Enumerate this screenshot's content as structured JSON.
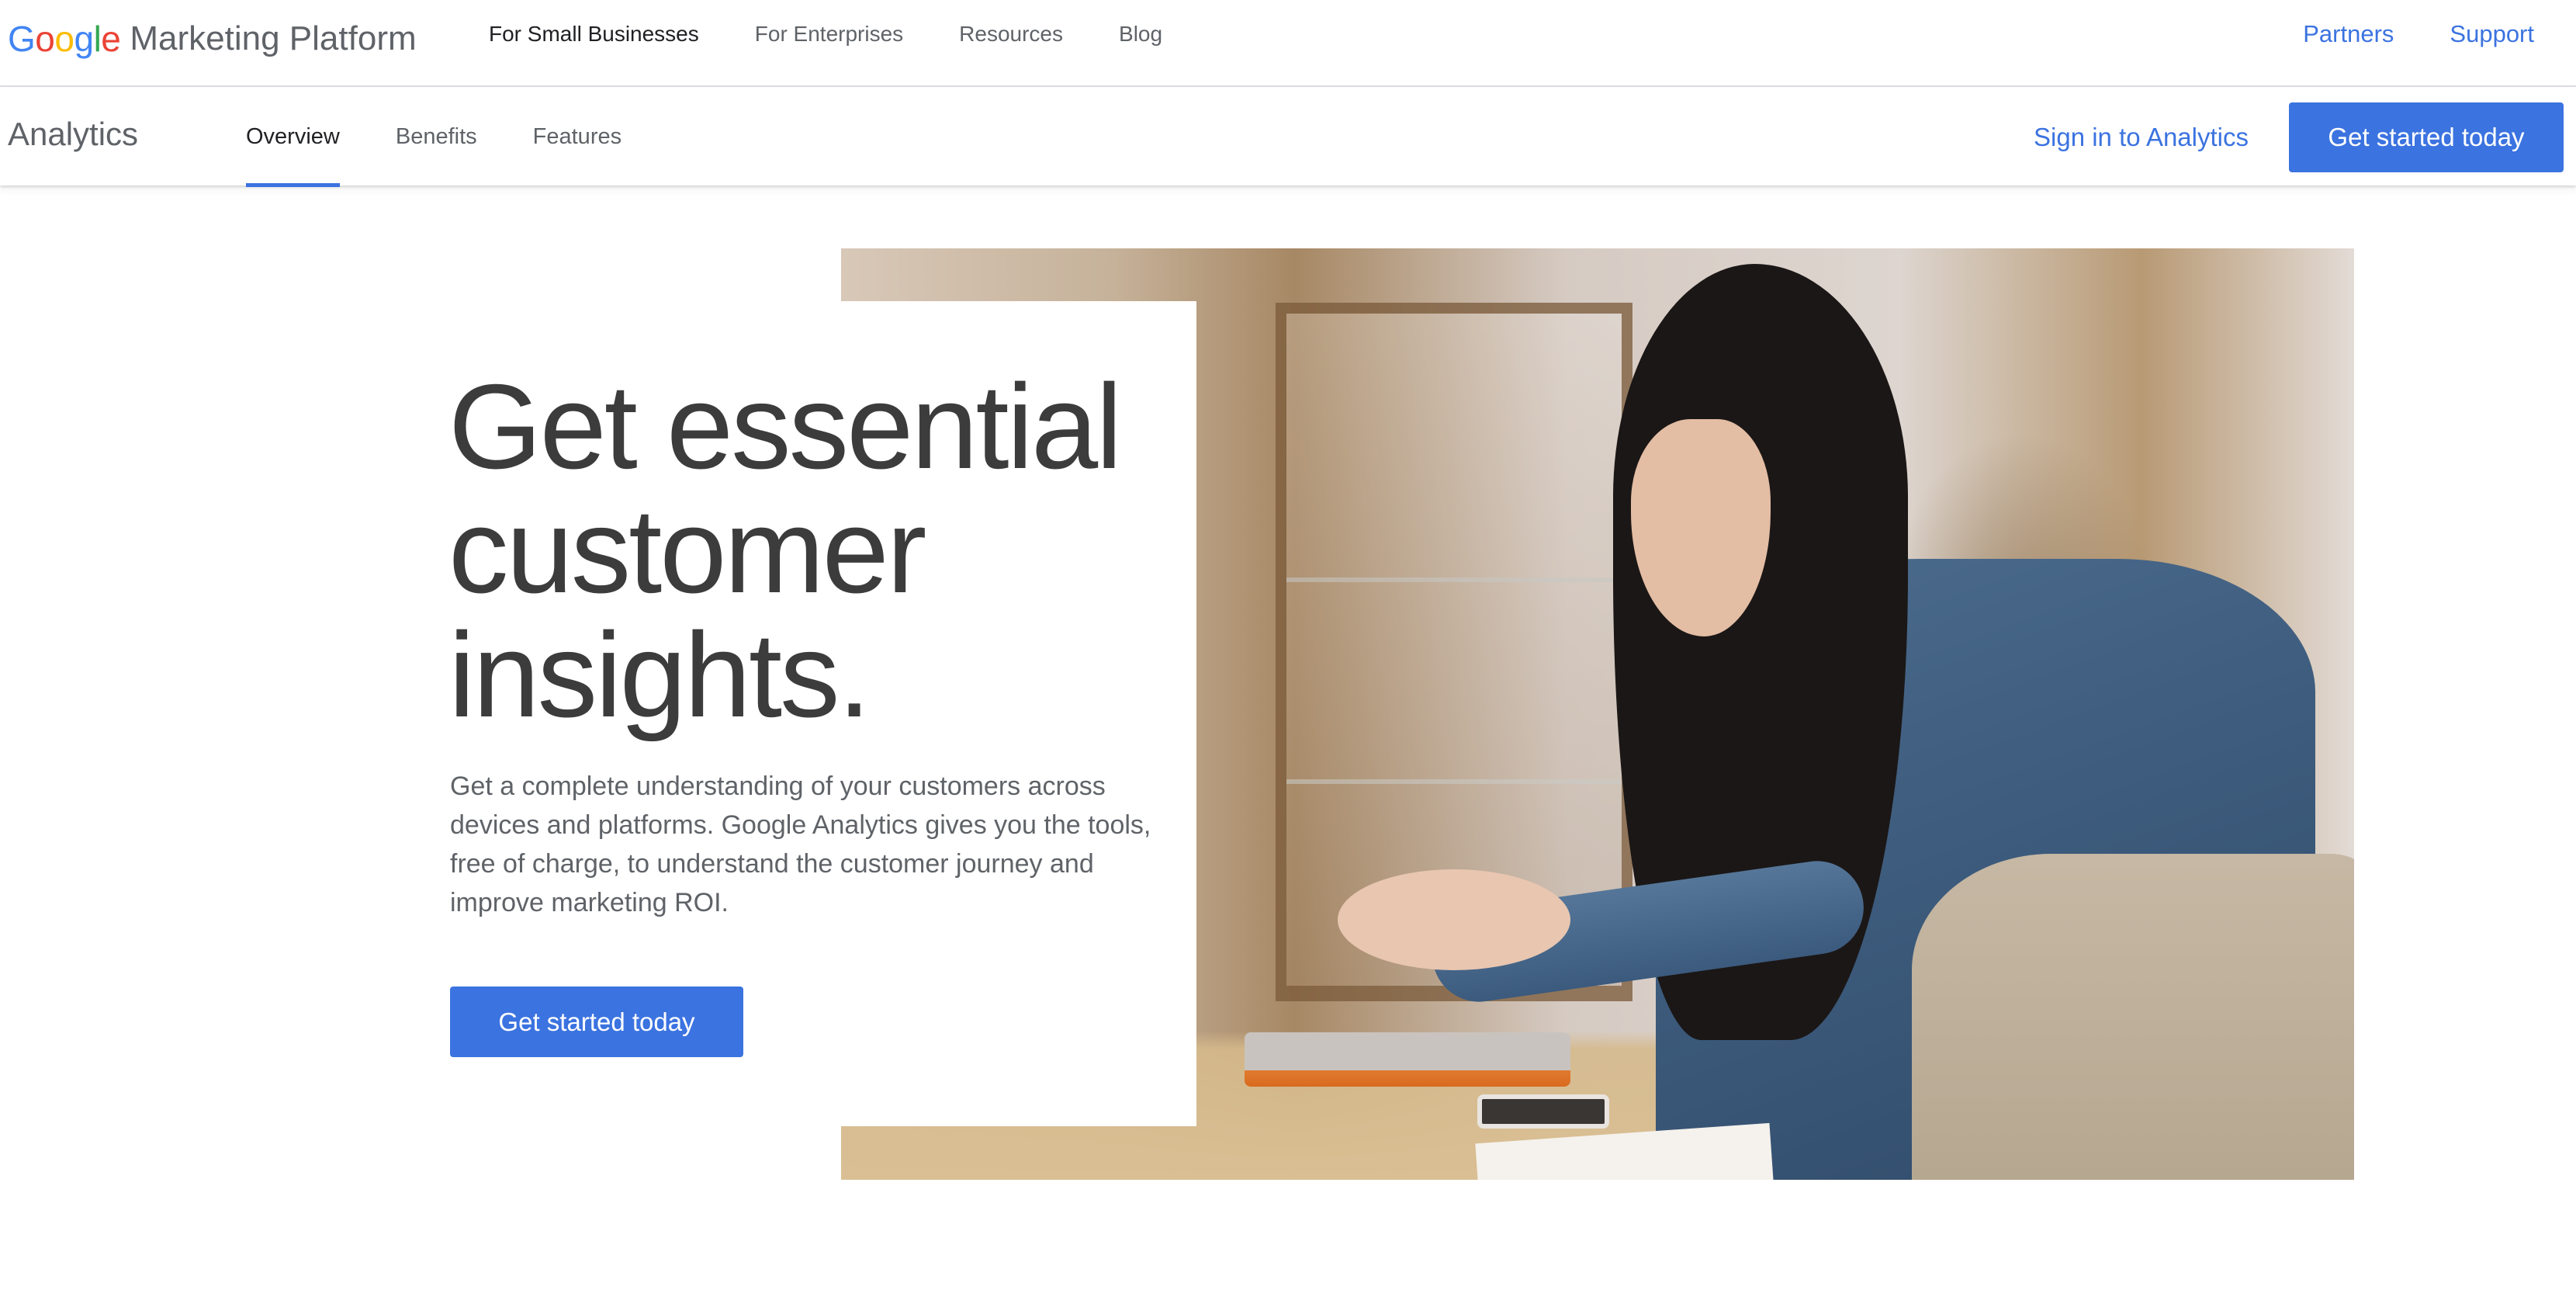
{
  "brand": {
    "logo_letters": [
      {
        "char": "G",
        "color": "#4285f4"
      },
      {
        "char": "o",
        "color": "#ea4335"
      },
      {
        "char": "o",
        "color": "#fbbc05"
      },
      {
        "char": "g",
        "color": "#4285f4"
      },
      {
        "char": "l",
        "color": "#34a853"
      },
      {
        "char": "e",
        "color": "#ea4335"
      }
    ],
    "product": "Marketing Platform"
  },
  "top_nav": {
    "links": [
      {
        "label": "For Small Businesses",
        "current": true
      },
      {
        "label": "For Enterprises",
        "current": false
      },
      {
        "label": "Resources",
        "current": false
      },
      {
        "label": "Blog",
        "current": false
      }
    ],
    "right_links": [
      {
        "label": "Partners"
      },
      {
        "label": "Support"
      }
    ]
  },
  "sub_nav": {
    "product_name": "Analytics",
    "tabs": [
      {
        "label": "Overview",
        "active": true
      },
      {
        "label": "Benefits",
        "active": false
      },
      {
        "label": "Features",
        "active": false
      }
    ],
    "sign_in_label": "Sign in to Analytics",
    "cta_label": "Get started today"
  },
  "hero": {
    "title_lines": [
      "Get essential",
      "customer",
      "insights."
    ],
    "body": "Get a complete understanding of your customers across devices and platforms. Google Analytics gives you the tools, free of charge, to understand the customer journey and improve marketing ROI.",
    "cta_label": "Get started today",
    "image_alt": "Woman working on a laptop at a shop counter"
  },
  "colors": {
    "accent": "#3b73e0",
    "text_dark": "#3c3c3c",
    "text_muted": "#5f6368",
    "divider": "#dadce0"
  }
}
